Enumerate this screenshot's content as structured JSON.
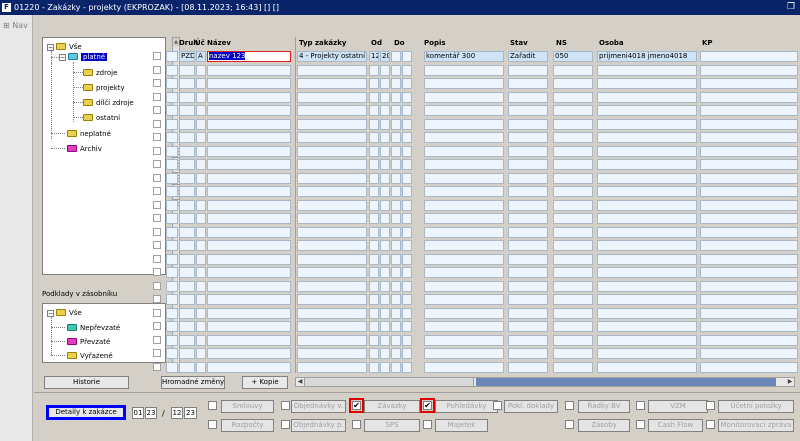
{
  "window": {
    "title": "01220 - Zakázky - projekty (EKPROZAK) - [08.11.2023; 16:43] [] []",
    "restore_icon": "restore-icon"
  },
  "nav": {
    "label": "Nav"
  },
  "tree": {
    "root": "Vše",
    "items": [
      {
        "label": "platné",
        "selected": true
      },
      {
        "label": "zdroje"
      },
      {
        "label": "projekty"
      },
      {
        "label": "dílčí zdroje"
      },
      {
        "label": "ostatní"
      },
      {
        "label": "neplatné"
      },
      {
        "label": "Archiv"
      }
    ]
  },
  "tree2": {
    "header": "Podklady v zásobníku",
    "root": "Vše",
    "items": [
      {
        "label": "Nepřevzaté"
      },
      {
        "label": "Převzaté"
      },
      {
        "label": "Vyřazené"
      }
    ]
  },
  "grid": {
    "headers": {
      "druh": "Druh",
      "uc": "Úč",
      "nazev": "Název",
      "typ": "Typ zakázky",
      "od": "Od",
      "do": "Do",
      "popis": "Popis",
      "stav": "Stav",
      "ns": "NS",
      "osoba": "Osoba",
      "kp": "KP"
    },
    "row1": {
      "druh": "PZD",
      "uc": "A",
      "nazev": "nazev 123",
      "typ": "4 - Projekty ostatní",
      "od": "12",
      "do": "20",
      "popis": "komentář 300",
      "stav": "Zařadit",
      "ns": "050",
      "osoba": "prijmeni4018 jmeno4018"
    }
  },
  "buttons": {
    "historie": "Historie",
    "hromadne": "Hromadné změny",
    "kopie": "+ Kopie",
    "detaily": "Detaily k zakázce"
  },
  "period": {
    "from_month": "01",
    "from_year": "23",
    "sep": "/",
    "to_month": "12",
    "to_year": "23"
  },
  "toggles": {
    "smlouvy": "Smlouvy",
    "objednavky_v": "Objednávky v.",
    "zavazky": "Závazky",
    "pohledavky": "Pohledávky",
    "pokl_doklady": "Pokl. doklady",
    "radky_bv": "Řádky BV",
    "vzm": "VZM",
    "ucetni_polozky": "Účetní položky",
    "rozpocty": "Rozpočty",
    "objednavky_p": "Objednávky p.",
    "sps": "SPS",
    "majetek": "Majetek",
    "zasoby": "Zásoby",
    "cash_flow": "Cash Flow",
    "monitorovaci": "Monitorovací zpráva",
    "checked_mark": "✔"
  }
}
